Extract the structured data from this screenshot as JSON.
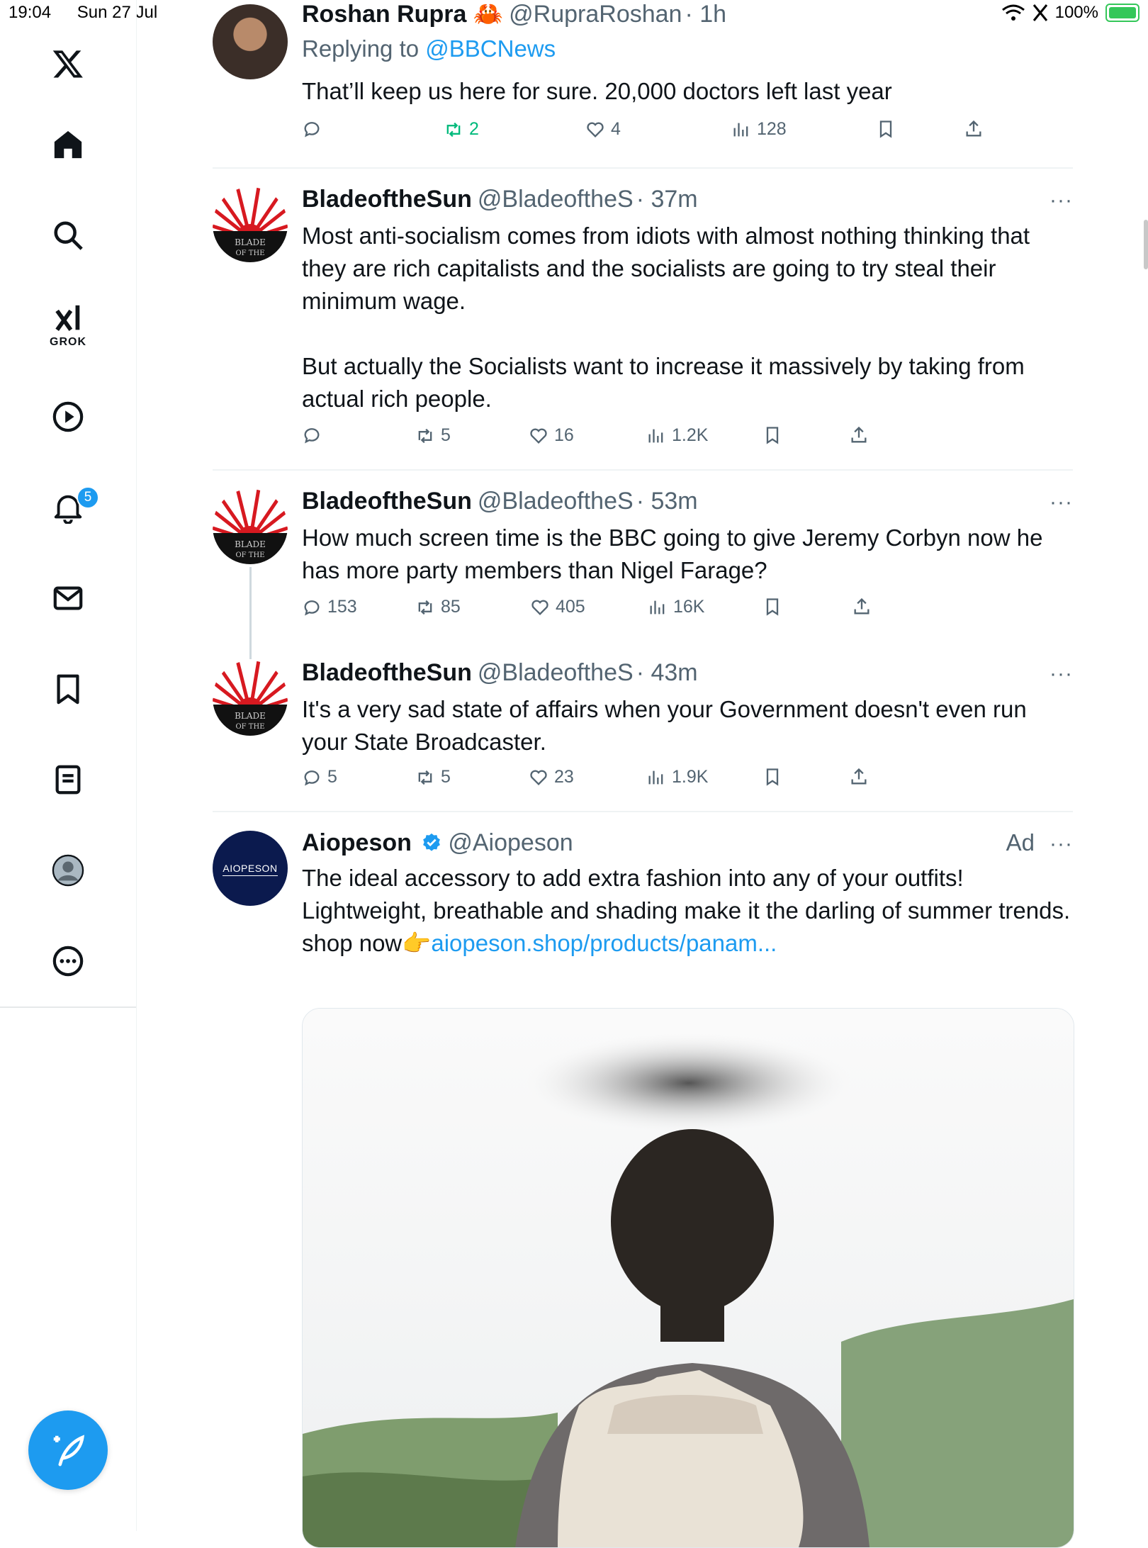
{
  "status_bar": {
    "time": "19:04",
    "date": "Sun 27 Jul",
    "battery": "100%"
  },
  "sidebar": {
    "grok_label": "GROK",
    "notifications_badge": "5"
  },
  "tweets": [
    {
      "name": "Roshan Rupra 🦀",
      "handle": "@RupraRoshan",
      "time": "· 1h",
      "replying_to_prefix": "Replying to ",
      "replying_to": "@BBCNews",
      "text": "That’ll keep us here for sure. 20,000 doctors left last year",
      "reply_count": "",
      "retweet_count": "2",
      "like_count": "4",
      "view_count": "128"
    },
    {
      "name": "BladeoftheSun",
      "handle": "@BladeoftheS",
      "time": "· 37m",
      "more": "···",
      "text_p1": "Most anti-socialism comes from idiots with almost nothing thinking that they are rich capitalists and the socialists are going to try steal their minimum wage.",
      "text_p2": "But actually the Socialists want to increase it massively by taking from actual rich people.",
      "reply_count": "",
      "retweet_count": "5",
      "like_count": "16",
      "view_count": "1.2K"
    },
    {
      "name": "BladeoftheSun",
      "handle": "@BladeoftheS",
      "time": "· 53m",
      "more": "···",
      "text": "How much screen time is the BBC going to give Jeremy Corbyn now he has more party members than Nigel Farage?",
      "reply_count": "153",
      "retweet_count": "85",
      "like_count": "405",
      "view_count": "16K"
    },
    {
      "name": "BladeoftheSun",
      "handle": "@BladeoftheS",
      "time": "· 43m",
      "more": "···",
      "text": "It's a very sad state of affairs when your Government doesn't even run your State Broadcaster.",
      "reply_count": "5",
      "retweet_count": "5",
      "like_count": "23",
      "view_count": "1.9K"
    },
    {
      "name": "Aiopeson",
      "handle": "@Aiopeson",
      "ad_label": "Ad",
      "more": "···",
      "avatar_text": "AIOPESON",
      "text": "The ideal accessory to add extra fashion into any of your outfits! Lightweight, breathable and shading make it the darling of summer trends.",
      "shop_prefix": "shop now👉",
      "shop_link": "aiopeson.shop/products/panam..."
    }
  ],
  "colors": {
    "accent": "#1d9bf0",
    "muted": "#536471",
    "retweet_green": "#00ba7c",
    "avatar_red": "#d71920"
  }
}
